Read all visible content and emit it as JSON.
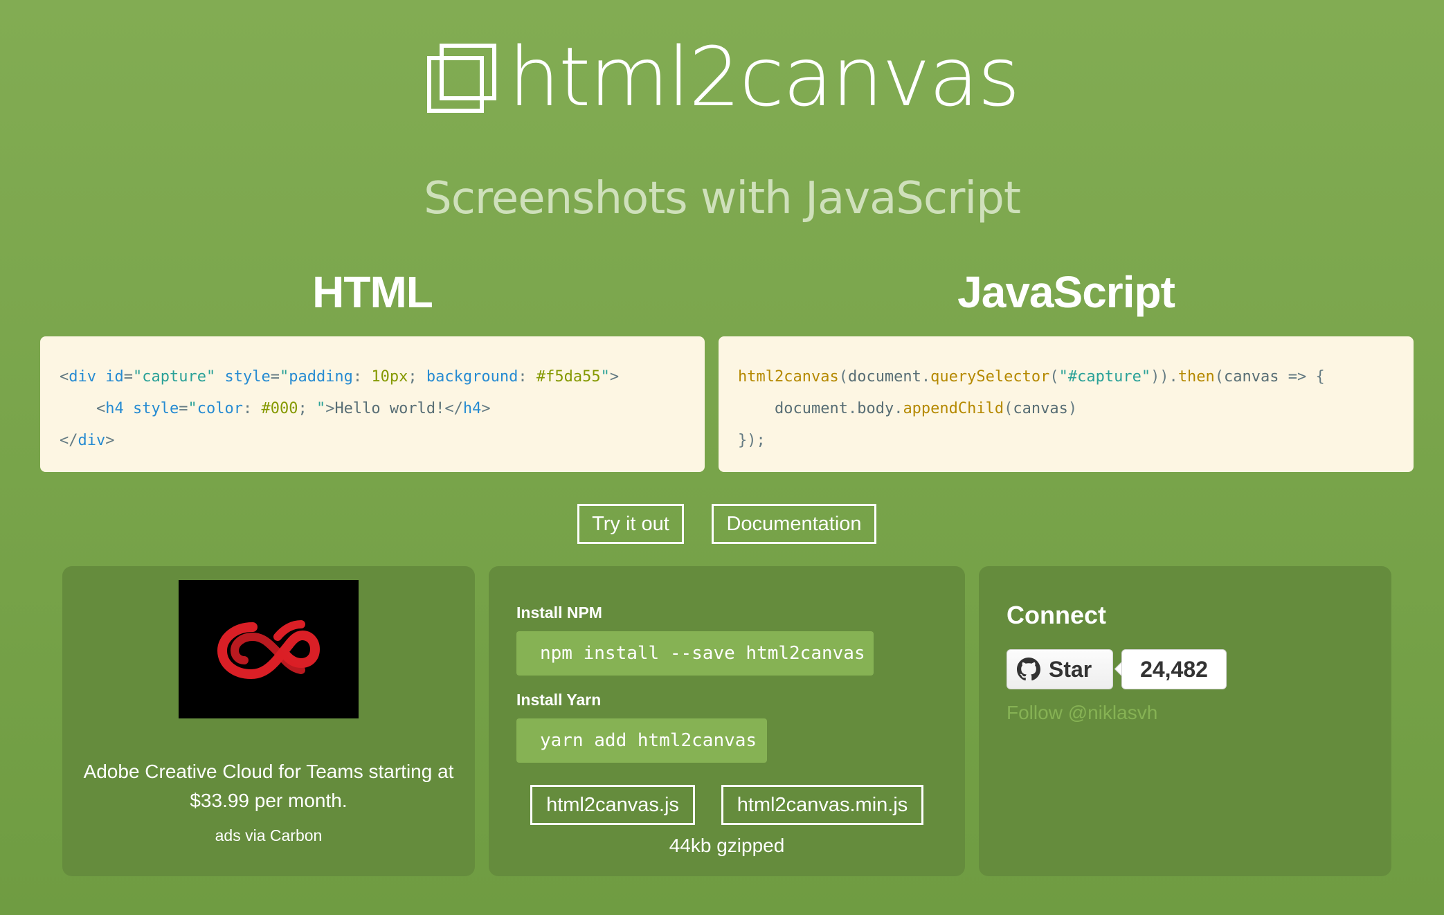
{
  "header": {
    "title": "html2canvas",
    "tagline": "Screenshots with JavaScript"
  },
  "code": {
    "html_title": "HTML",
    "js_title": "JavaScript",
    "html_snippet": [
      "<div id=\"capture\" style=\"padding: 10px; background: #f5da55\">",
      "    <h4 style=\"color: #000; \">Hello world!</h4>",
      "</div>"
    ],
    "js_snippet": [
      "html2canvas(document.querySelector(\"#capture\")).then(canvas => {",
      "    document.body.appendChild(canvas)",
      "});"
    ]
  },
  "actions": {
    "try_label": "Try it out",
    "docs_label": "Documentation"
  },
  "ad": {
    "image_icon": "adobe-creative-cloud-logo",
    "text": "Adobe Creative Cloud for Teams starting at $33.99 per month.",
    "via": "ads via Carbon"
  },
  "install": {
    "npm_label": "Install NPM",
    "npm_command": "npm install --save html2canvas",
    "yarn_label": "Install Yarn",
    "yarn_command": "yarn add html2canvas",
    "file1": "html2canvas.js",
    "file2": "html2canvas.min.js",
    "size_note": "44kb gzipped"
  },
  "connect": {
    "title": "Connect",
    "star_label": "Star",
    "star_count": "24,482",
    "follow": "Follow @niklasvh"
  },
  "colors": {
    "background": "#7aa54b",
    "panel": "#658c3d",
    "code_bg": "#fdf6e3",
    "command_bg": "#86b254"
  }
}
